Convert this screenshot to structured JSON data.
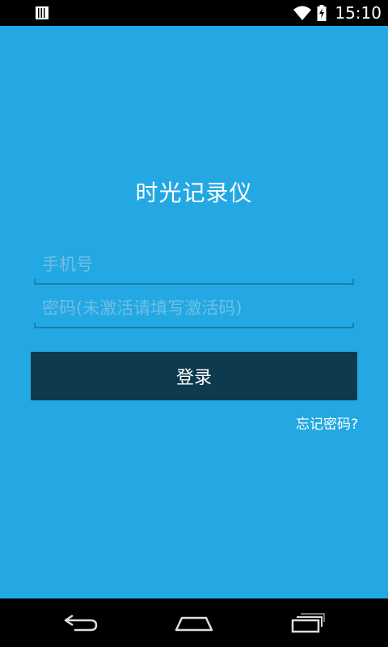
{
  "status_bar": {
    "time": "15:10",
    "icons": [
      "sim-icon",
      "wifi-icon",
      "battery-charging-icon"
    ]
  },
  "login": {
    "title": "时光记录仪",
    "phone_placeholder": "手机号",
    "phone_value": "",
    "password_placeholder": "密码(未激活请填写激活码)",
    "password_value": "",
    "login_button_label": "登录",
    "forgot_password_label": "忘记密码?"
  },
  "nav_bar": {
    "icons": [
      "back-icon",
      "home-icon",
      "recent-apps-icon"
    ]
  },
  "colors": {
    "background": "#23a8e3",
    "button": "#0d3a4f",
    "underline": "#1a7fad",
    "placeholder": "#6fbfe2",
    "text": "#ffffff"
  }
}
